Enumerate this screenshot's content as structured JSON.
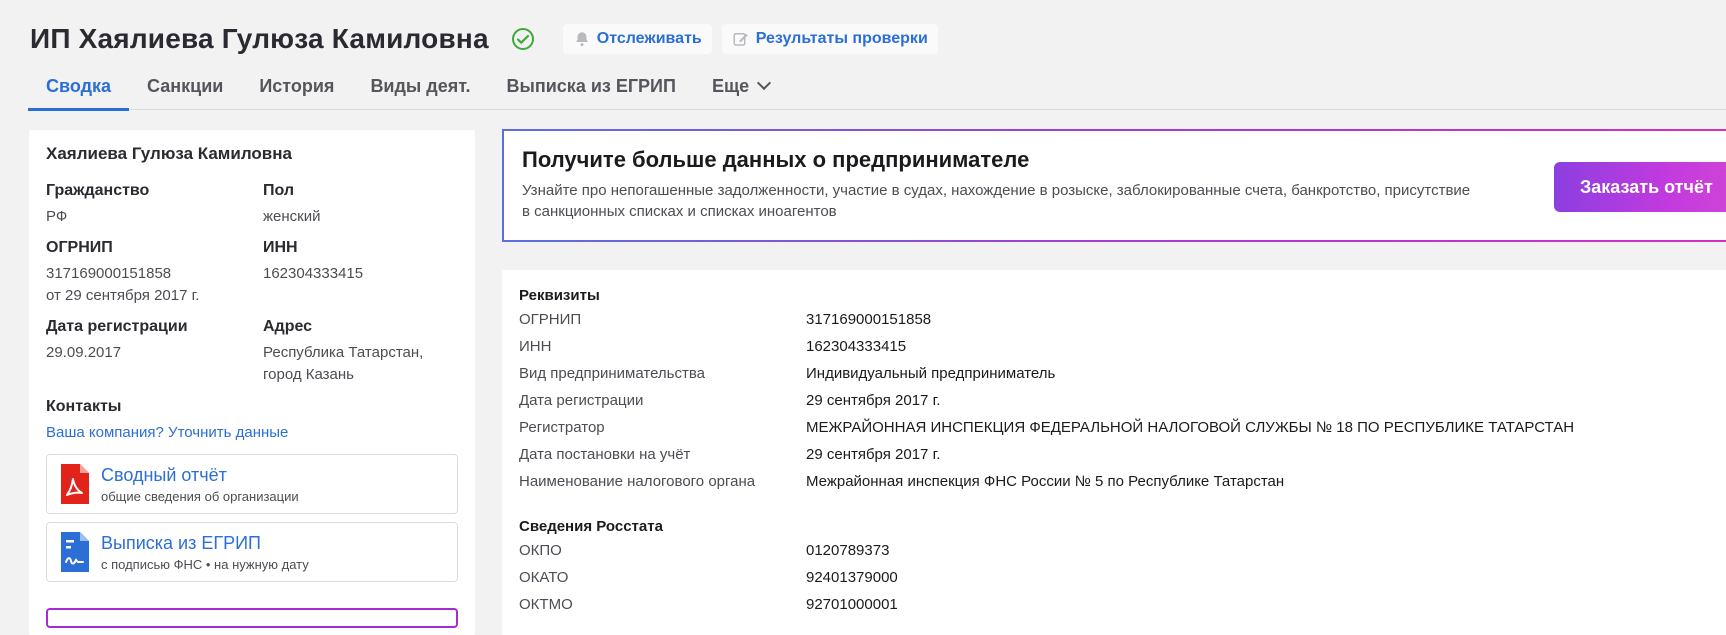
{
  "header": {
    "title": "ИП Хаялиева Гулюза Камиловна",
    "track_label": "Отслеживать",
    "results_label": "Результаты проверки"
  },
  "tabs": [
    {
      "label": "Сводка",
      "active": true
    },
    {
      "label": "Санкции"
    },
    {
      "label": "История"
    },
    {
      "label": "Виды деят."
    },
    {
      "label": "Выписка из ЕГРИП"
    },
    {
      "label": "Еще"
    }
  ],
  "summary": {
    "name": "Хаялиева Гулюза Камиловна",
    "citizenship_label": "Гражданство",
    "citizenship": "РФ",
    "sex_label": "Пол",
    "sex": "женский",
    "ogrnip_label": "ОГРНИП",
    "ogrnip": "317169000151858",
    "ogrnip_date": "от 29 сентября 2017 г.",
    "inn_label": "ИНН",
    "inn": "162304333415",
    "reg_date_label": "Дата регистрации",
    "reg_date": "29.09.2017",
    "address_label": "Адрес",
    "address": "Республика Татарстан, город Казань",
    "contacts_label": "Контакты",
    "contacts_link": "Ваша компания? Уточнить данные",
    "docs": [
      {
        "title": "Сводный отчёт",
        "subtitle": "общие сведения об организации"
      },
      {
        "title": "Выписка из ЕГРИП",
        "subtitle": "с подписью ФНС • на нужную дату"
      }
    ]
  },
  "promo": {
    "title": "Получите больше данных о предпринимателе",
    "text": "Узнайте про непогашенные задолженности, участие в судах, нахождение в розыске, заблокированные счета, банкротство, присутствие в санкционных списках и списках иноагентов",
    "button": "Заказать отчёт"
  },
  "details": {
    "requisites_title": "Реквизиты",
    "requisites": [
      {
        "key": "ОГРНИП",
        "value": "317169000151858"
      },
      {
        "key": "ИНН",
        "value": "162304333415"
      },
      {
        "key": "Вид предпринимательства",
        "value": "Индивидуальный предприниматель"
      },
      {
        "key": "Дата регистрации",
        "value": "29 сентября 2017 г."
      },
      {
        "key": "Регистратор",
        "value": "МЕЖРАЙОННАЯ ИНСПЕКЦИЯ ФЕДЕРАЛЬНОЙ НАЛОГОВОЙ СЛУЖБЫ № 18 ПО РЕСПУБЛИКЕ ТАТАРСТАН"
      },
      {
        "key": "Дата постановки на учёт",
        "value": "29 сентября 2017 г."
      },
      {
        "key": "Наименование налогового органа",
        "value": "Межрайонная инспекция ФНС России № 5 по Республике Татарстан"
      }
    ],
    "rosstat_title": "Сведения Росстата",
    "rosstat": [
      {
        "key": "ОКПО",
        "value": "0120789373"
      },
      {
        "key": "ОКАТО",
        "value": "92401379000"
      },
      {
        "key": "ОКТМО",
        "value": "92701000001"
      }
    ]
  },
  "colors": {
    "accent": "#2b6fd6",
    "verified": "#3ea83a",
    "pdf": "#e2231a"
  }
}
